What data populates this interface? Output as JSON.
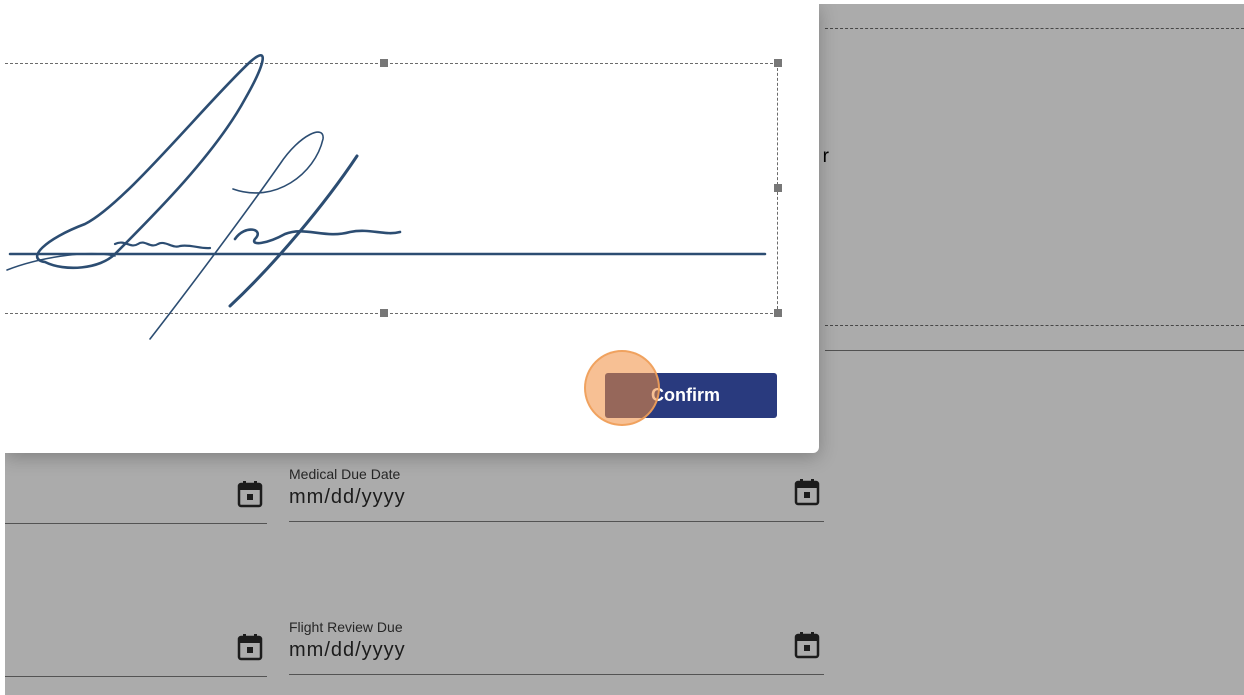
{
  "background": {
    "partial_text": "or",
    "fields": [
      {
        "label": "",
        "placeholder": ""
      },
      {
        "label": "Medical Due Date",
        "placeholder": "mm/dd/yyyy"
      },
      {
        "label": "",
        "placeholder": ""
      },
      {
        "label": "Flight Review Due",
        "placeholder": "mm/dd/yyyy"
      }
    ],
    "calendar_icon": "calendar-icon"
  },
  "modal": {
    "confirm_label": "Confirm",
    "signature_image": "handwritten-signature",
    "accent_color": "#293a7e",
    "click_indicator_color": "#f08c3c"
  }
}
